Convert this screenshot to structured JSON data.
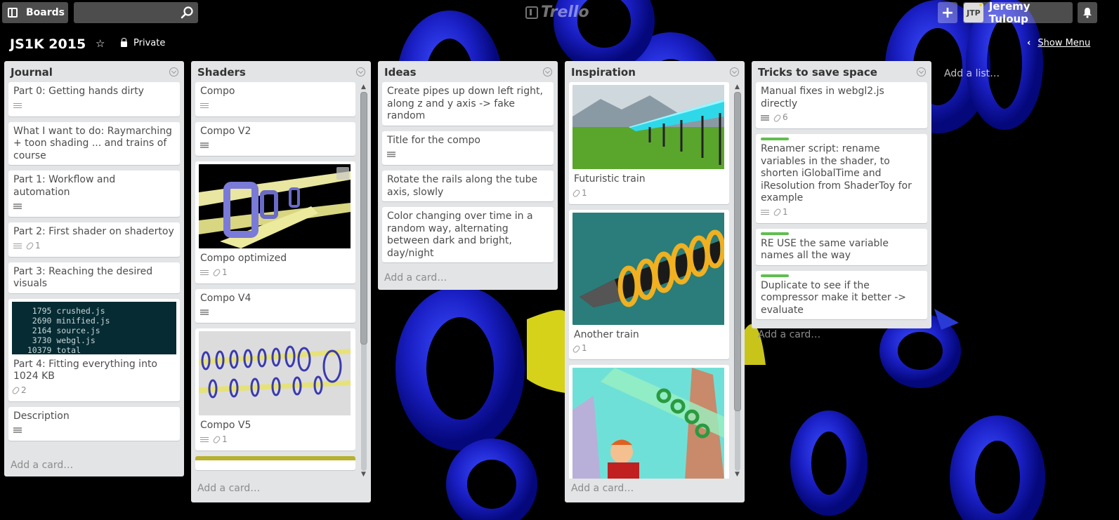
{
  "topbar": {
    "boards_label": "Boards",
    "search_value": "",
    "logo_text": "Trello",
    "user_initials": "JTP",
    "user_name": "Jeremy Tuloup"
  },
  "board": {
    "title": "JS1K 2015",
    "privacy": "Private",
    "show_menu": "Show Menu",
    "add_list": "Add a list…"
  },
  "add_card_label": "Add a card…",
  "lists": [
    {
      "name": "Journal",
      "cards": [
        {
          "title": "Part 0: Getting hands dirty",
          "desc": true
        },
        {
          "title": "What I want to do: Raymarching + toon shading ... and trains of course"
        },
        {
          "title": "Part 1: Workflow and automation",
          "desc": true
        },
        {
          "title": "Part 2: First shader on shadertoy",
          "desc": true,
          "attachments": "1"
        },
        {
          "title": "Part 3: Reaching the desired visuals"
        },
        {
          "title": "Part 4: Fitting everything into 1024 KB",
          "attachments": "2",
          "console": [
            "   1795 crushed.js",
            "   2690 minified.js",
            "   2164 source.js",
            "   3730 webgl.js",
            "  10379 total"
          ]
        },
        {
          "title": "Description",
          "desc": true
        }
      ]
    },
    {
      "name": "Shaders",
      "cards": [
        {
          "title": "Compo",
          "desc": true
        },
        {
          "title": "Compo V2",
          "desc": true
        },
        {
          "title": "Compo optimized",
          "desc": true,
          "attachments": "1",
          "cover": "rails-closeup"
        },
        {
          "title": "Compo V4",
          "desc": true
        },
        {
          "title": "Compo V5",
          "desc": true,
          "attachments": "1",
          "cover": "rings-rails"
        }
      ]
    },
    {
      "name": "Ideas",
      "cards": [
        {
          "title": "Create pipes up down left right, along z and y axis -> fake random"
        },
        {
          "title": "Title for the compo",
          "desc": true
        },
        {
          "title": "Rotate the rails along the tube axis, slowly"
        },
        {
          "title": "Color changing over time in a random way, alternating between dark and bright, day/night"
        }
      ]
    },
    {
      "name": "Inspiration",
      "cards": [
        {
          "title": "Futuristic train",
          "attachments": "1",
          "cover": "tube-train"
        },
        {
          "title": "Another train",
          "attachments": "1",
          "cover": "drill-train"
        },
        {
          "title": "",
          "cover": "cartoon-city"
        }
      ]
    },
    {
      "name": "Tricks to save space",
      "cards": [
        {
          "title": "Manual fixes in webgl2.js directly",
          "desc": true,
          "attachments": "6"
        },
        {
          "title": "Renamer script: rename variables in the shader, to shorten iGlobalTime and iResolution from ShaderToy for example",
          "desc": true,
          "attachments": "1",
          "label": "#61bd4f"
        },
        {
          "title": "RE USE the same variable names all the way",
          "label": "#61bd4f"
        },
        {
          "title": "Duplicate to see if the compressor make it better -> evaluate",
          "label": "#61bd4f"
        }
      ]
    }
  ],
  "icons": {
    "boards": "boards-icon",
    "search": "search-icon",
    "plus": "plus-icon",
    "bell": "bell-icon",
    "star": "star-icon",
    "lock": "lock-icon",
    "chevron": "chevron-left-icon"
  },
  "colors": {
    "list_bg": "#e2e4e6",
    "label_green": "#61bd4f",
    "header_button": "rgba(255,255,255,0.3)"
  }
}
